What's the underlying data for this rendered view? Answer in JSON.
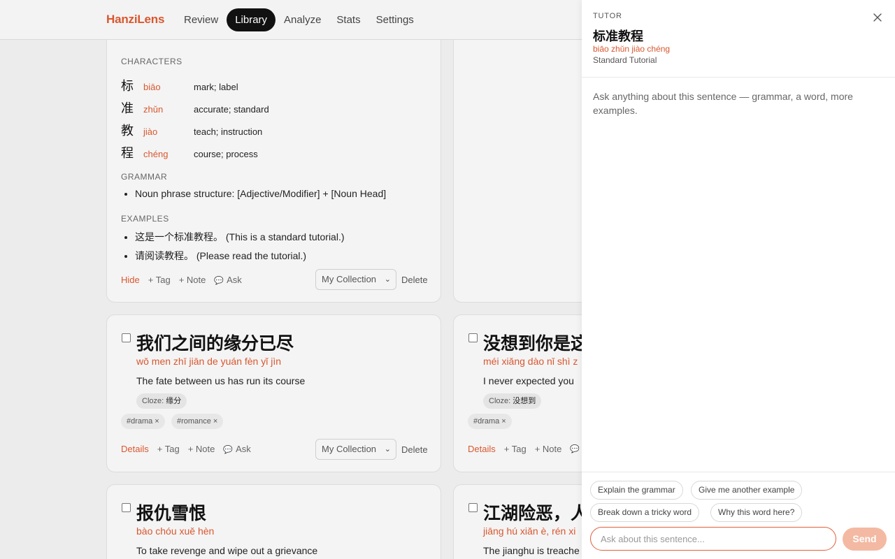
{
  "app": {
    "logo": "HanziLens"
  },
  "nav": [
    {
      "label": "Review",
      "active": false
    },
    {
      "label": "Library",
      "active": true
    },
    {
      "label": "Analyze",
      "active": false
    },
    {
      "label": "Stats",
      "active": false
    },
    {
      "label": "Settings",
      "active": false
    }
  ],
  "colors": {
    "accent": "#d9572f",
    "active_nav": "#111111",
    "send_disabled": "#f4b9a2"
  },
  "expanded_card": {
    "characters_heading": "CHARACTERS",
    "characters": [
      {
        "hanzi": "标",
        "pinyin": "biāo",
        "meaning": "mark; label"
      },
      {
        "hanzi": "准",
        "pinyin": "zhǔn",
        "meaning": "accurate; standard"
      },
      {
        "hanzi": "教",
        "pinyin": "jiào",
        "meaning": "teach; instruction"
      },
      {
        "hanzi": "程",
        "pinyin": "chéng",
        "meaning": "course; process"
      }
    ],
    "grammar_heading": "GRAMMAR",
    "grammar": [
      "Noun phrase structure: [Adjective/Modifier] + [Noun Head]"
    ],
    "examples_heading": "EXAMPLES",
    "examples": [
      "这是一个标准教程。 (This is a standard tutorial.)",
      "请阅读教程。 (Please read the tutorial.)"
    ],
    "actions": {
      "toggle": "Hide",
      "tag": "+ Tag",
      "note": "+ Note",
      "ask": "Ask",
      "collection": "My Collection",
      "delete": "Delete"
    }
  },
  "cards": [
    {
      "hanzi": "我们之间的缘分已尽",
      "pinyin": "wǒ men zhī jiān de yuán fèn yǐ jìn",
      "translation": "The fate between us has run its course",
      "cloze_label": "Cloze:",
      "cloze_word": "缘分",
      "tags": [
        "#drama",
        "#romance"
      ],
      "actions": {
        "toggle": "Details",
        "tag": "+ Tag",
        "note": "+ Note",
        "ask": "Ask",
        "collection": "My Collection",
        "delete": "Delete"
      }
    },
    {
      "hanzi": "没想到你是这",
      "pinyin": "méi xiǎng dào nǐ shì z",
      "translation": "I never expected you",
      "cloze_label": "Cloze:",
      "cloze_word": "没想到",
      "tags": [
        "#drama"
      ],
      "actions": {
        "toggle": "Details",
        "tag": "+ Tag",
        "note": "+ Note"
      }
    },
    {
      "hanzi": "报仇雪恨",
      "pinyin": "bào chóu xuě hèn",
      "translation": "To take revenge and wipe out a grievance"
    },
    {
      "hanzi": "江湖险恶，人",
      "pinyin": "jiāng hú xiǎn è, rén xi",
      "translation": "The jianghu is treache"
    }
  ],
  "tutor": {
    "label": "TUTOR",
    "title": "标准教程",
    "pinyin": "biāo zhǔn jiào chéng",
    "translation": "Standard Tutorial",
    "hint": "Ask anything about this sentence — grammar, a word, more examples.",
    "chips": [
      "Explain the grammar",
      "Give me another example",
      "Break down a tricky word",
      "Why this word here?"
    ],
    "input_placeholder": "Ask about this sentence...",
    "send_label": "Send"
  }
}
